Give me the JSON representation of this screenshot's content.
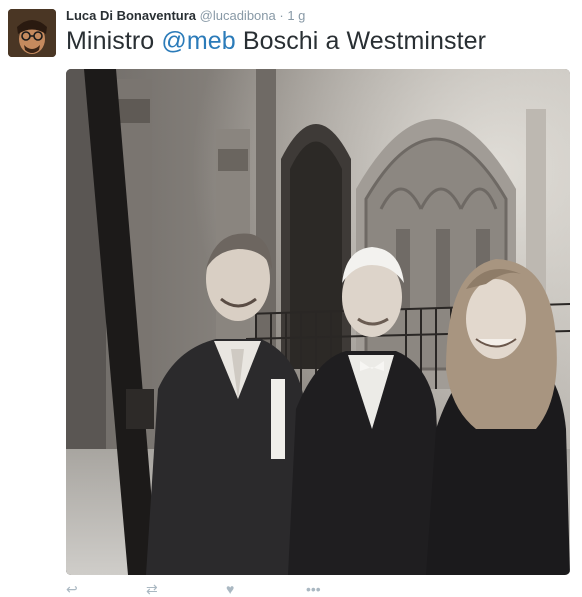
{
  "tweet": {
    "author_name": "Luca Di Bonaventura",
    "handle": "@lucadibona",
    "separator": "·",
    "time": "1 g",
    "text_before": "Ministro ",
    "mention": "@meb",
    "text_after": " Boschi a Westminster"
  },
  "icons": {
    "reply": "reply-icon",
    "retweet": "retweet-icon",
    "like": "heart-icon",
    "more": "more-icon"
  },
  "colors": {
    "link": "#2b7bb9",
    "muted": "#8899a6",
    "text": "#292f33"
  }
}
